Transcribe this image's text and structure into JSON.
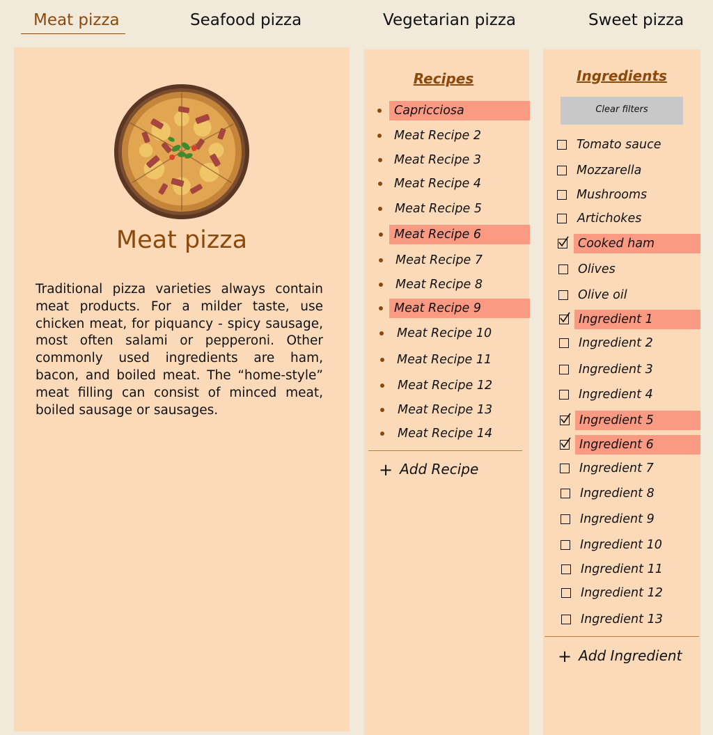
{
  "tabs": [
    {
      "label": "Meat pizza",
      "active": true
    },
    {
      "label": "Seafood pizza",
      "active": false
    },
    {
      "label": "Vegetarian pizza",
      "active": false
    },
    {
      "label": "Sweet pizza",
      "active": false
    }
  ],
  "main": {
    "title": "Meat pizza",
    "description": "Traditional pizza varieties always contain meat products. For a milder taste, use chicken meat, for piquancy - spicy sausage, most often salami or pepperoni. Other commonly used ingredients are ham, bacon, and boiled meat. The “home-style” meat filling can consist of minced meat, boiled sausage or sausages."
  },
  "recipes": {
    "heading": "Recipes",
    "items": [
      {
        "label": "Capricciosa",
        "selected": true
      },
      {
        "label": "Meat Recipe 2",
        "selected": false
      },
      {
        "label": "Meat Recipe 3",
        "selected": false
      },
      {
        "label": "Meat Recipe 4",
        "selected": false
      },
      {
        "label": "Meat Recipe 5",
        "selected": false
      },
      {
        "label": "Meat Recipe 6",
        "selected": true
      },
      {
        "label": "Meat Recipe 7",
        "selected": false
      },
      {
        "label": "Meat Recipe 8",
        "selected": false
      },
      {
        "label": "Meat Recipe 9",
        "selected": true
      },
      {
        "label": "Meat Recipe 10",
        "selected": false
      },
      {
        "label": "Meat Recipe 11",
        "selected": false
      },
      {
        "label": "Meat Recipe 12",
        "selected": false
      },
      {
        "label": "Meat Recipe 13",
        "selected": false
      },
      {
        "label": "Meat Recipe 14",
        "selected": false
      }
    ],
    "add_label": "Add Recipe"
  },
  "ingredients": {
    "heading": "Ingredients",
    "clear_label": "Clear filters",
    "items": [
      {
        "label": "Tomato sauce",
        "checked": false
      },
      {
        "label": "Mozzarella",
        "checked": false
      },
      {
        "label": "Mushrooms",
        "checked": false
      },
      {
        "label": "Artichokes",
        "checked": false
      },
      {
        "label": "Cooked ham",
        "checked": true
      },
      {
        "label": "Olives",
        "checked": false
      },
      {
        "label": "Olive oil",
        "checked": false
      },
      {
        "label": "Ingredient 1",
        "checked": true
      },
      {
        "label": "Ingredient 2",
        "checked": false
      },
      {
        "label": "Ingredient 3",
        "checked": false
      },
      {
        "label": "Ingredient 4",
        "checked": false
      },
      {
        "label": "Ingredient 5",
        "checked": true
      },
      {
        "label": "Ingredient 6",
        "checked": true
      },
      {
        "label": "Ingredient 7",
        "checked": false
      },
      {
        "label": "Ingredient 8",
        "checked": false
      },
      {
        "label": "Ingredient 9",
        "checked": false
      },
      {
        "label": "Ingredient 10",
        "checked": false
      },
      {
        "label": "Ingredient 11",
        "checked": false
      },
      {
        "label": "Ingredient 12",
        "checked": false
      },
      {
        "label": "Ingredient 13",
        "checked": false
      }
    ],
    "add_label": "Add Ingredient"
  },
  "colors": {
    "accent": "#8b4a0c",
    "panel": "#fbdab9",
    "page": "#f1e9da",
    "highlight": "#fa9a83"
  }
}
